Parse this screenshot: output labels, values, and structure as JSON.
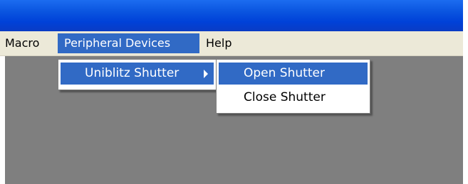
{
  "menubar": {
    "items": [
      {
        "label": "Macro"
      },
      {
        "label": "Peripheral Devices"
      },
      {
        "label": "Help"
      }
    ]
  },
  "peripheral_menu": {
    "items": [
      {
        "label": "Uniblitz Shutter",
        "icon": "submenu-arrow-icon"
      }
    ]
  },
  "shutter_menu": {
    "items": [
      {
        "label": "Open Shutter"
      },
      {
        "label": "Close Shutter"
      }
    ]
  },
  "colors": {
    "titlebar": "#0B56E0",
    "menubar": "#ECE9D8",
    "highlight": "#316AC5",
    "client": "#7F7F7F"
  }
}
